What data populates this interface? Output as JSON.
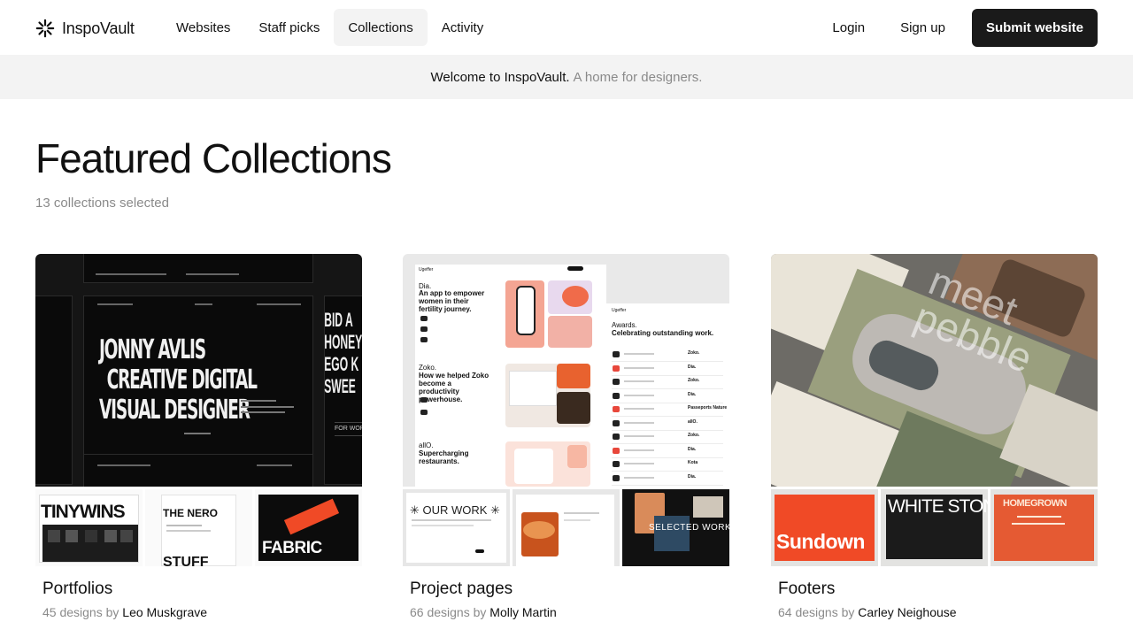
{
  "brand": {
    "name": "InspoVault"
  },
  "nav": {
    "items": [
      {
        "label": "Websites"
      },
      {
        "label": "Staff picks"
      },
      {
        "label": "Collections"
      },
      {
        "label": "Activity"
      }
    ],
    "active": "Collections",
    "login": "Login",
    "signup": "Sign up",
    "submit": "Submit website"
  },
  "banner": {
    "strong": "Welcome to InspoVault.",
    "muted": "A home for designers."
  },
  "page": {
    "title": "Featured Collections",
    "subtitle": "13 collections selected"
  },
  "collections": [
    {
      "title": "Portfolios",
      "count_text": "45 designs by",
      "author": "Leo Muskgrave",
      "hero_text": [
        "JONNY AVLIS",
        "CREATIVE DIGITAL",
        "VISUAL DESIGNER"
      ],
      "side_text": [
        "BID A",
        "HONEY",
        "EGO K",
        "SWEE"
      ],
      "side_label": "FOR WORK",
      "thumbs": [
        "TINYWINS",
        "THE NERO",
        "FABRIC"
      ],
      "thumb_extra": "STUFF"
    },
    {
      "title": "Project pages",
      "count_text": "66 designs by",
      "author": "Molly Martin",
      "hero_text": {
        "brand": "Ugeffer",
        "b1": "Dia.",
        "b1_text": "An app to empower women in their fertility journey.",
        "b2": "Zoko.",
        "b2_text": "How we helped Zoko become a productivity powerhouse.",
        "b3": "allO.",
        "b3_text": "Supercharging restaurants.",
        "side_brand": "Ugeffer",
        "side_title": "Awards.",
        "side_sub": "Celebrating outstanding work."
      },
      "side_rows": [
        "Zoko.",
        "Dia.",
        "Zoko.",
        "Dia.",
        "Passeports Nature",
        "allO.",
        "Zoko.",
        "Dia.",
        "Kota",
        "Dia."
      ],
      "thumbs": [
        "OUR WORK",
        "",
        "SELECTED WORKS"
      ]
    },
    {
      "title": "Footers",
      "count_text": "64 designs by",
      "author": "Carley Neighouse",
      "hero_text": [
        "meet",
        "pebble"
      ],
      "thumbs": [
        "Sundown",
        "WHITE STONE",
        "HOMEGROWN"
      ]
    }
  ],
  "colors": {
    "accent_dark": "#1a1a1a",
    "banner_bg": "#f3f3f3",
    "muted_text": "#8a8a8a",
    "orange": "#f04a26",
    "pink": "#f2b1a6"
  },
  "icons": {
    "logo": "asterisk-logo-icon"
  }
}
